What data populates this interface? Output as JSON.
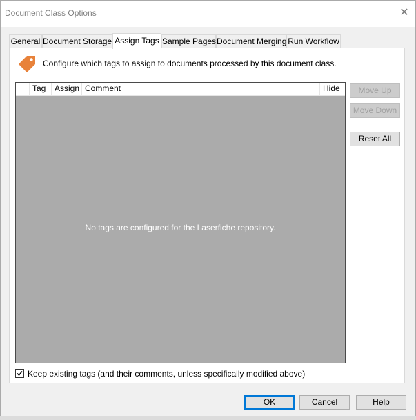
{
  "window": {
    "title": "Document Class Options"
  },
  "tabs": [
    {
      "label": "General"
    },
    {
      "label": "Document Storage"
    },
    {
      "label": "Assign Tags",
      "active": true
    },
    {
      "label": "Sample Pages"
    },
    {
      "label": "Document Merging"
    },
    {
      "label": "Run Workflow"
    }
  ],
  "assign_tags": {
    "description": "Configure which tags to assign to documents processed by this document class.",
    "icon": "tag-icon",
    "columns": [
      "Tag",
      "Assign",
      "Comment",
      "Hide"
    ],
    "empty_message": "No tags are configured for the Laserfiche repository.",
    "buttons": {
      "move_up": "Move Up",
      "move_down": "Move Down",
      "reset_all": "Reset All"
    },
    "keep_tags": {
      "label": "Keep existing tags (and their comments, unless specifically modified above)",
      "checked": true
    }
  },
  "footer": {
    "ok": "OK",
    "cancel": "Cancel",
    "help": "Help"
  },
  "colors": {
    "accent": "#0078d7",
    "tag_orange": "#e8823a",
    "grid_bg": "#ababab"
  }
}
